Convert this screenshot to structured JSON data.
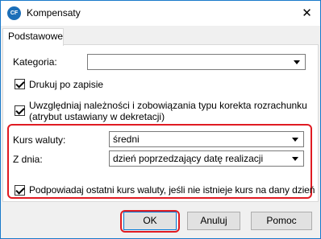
{
  "window": {
    "title": "Kompensaty",
    "icon_text": "CF",
    "close_glyph": "✕"
  },
  "tabs": [
    {
      "label": "Podstawowe"
    }
  ],
  "form": {
    "kategoria": {
      "label": "Kategoria:",
      "value": ""
    },
    "drukuj": {
      "label": "Drukuj po zapisie",
      "checked": true
    },
    "uwzgledniaj": {
      "line1": "Uwzględniaj należności i zobowiązania typu korekta rozrachunku",
      "line2": "(atrybut ustawiany w dekretacji)",
      "checked": true
    },
    "kurs": {
      "label": "Kurs waluty:",
      "value": "średni"
    },
    "zdnia": {
      "label": "Z dnia:",
      "value": "dzień poprzedzający datę realizacji"
    },
    "podpowiadaj": {
      "label": "Podpowiadaj ostatni kurs waluty, jeśli nie istnieje kurs na dany dzień",
      "checked": true
    }
  },
  "buttons": {
    "ok": "OK",
    "cancel": "Anuluj",
    "help": "Pomoc"
  },
  "colors": {
    "highlight": "#e01b22",
    "window_border": "#1979ca",
    "focus": "#0078d7"
  }
}
